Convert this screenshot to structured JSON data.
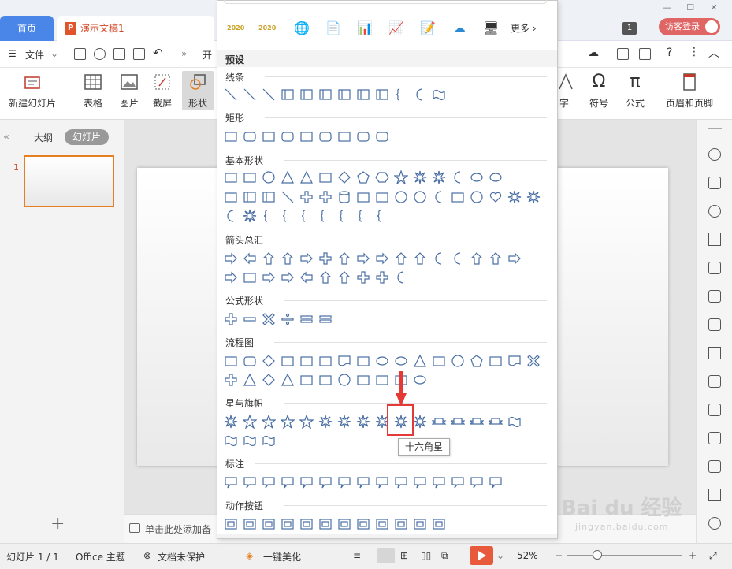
{
  "titlebar": {
    "home_tab": "首页",
    "doc_tab": "演示文稿1",
    "badge": "1",
    "login": "访客登录",
    "win_controls": [
      "—",
      "☐",
      "✕"
    ]
  },
  "menu": {
    "file": "文件",
    "partial_tab": "开"
  },
  "ribbon": {
    "new_slide": "新建幻灯片",
    "table": "表格",
    "picture": "图片",
    "screenshot": "截屏",
    "shape": "形状",
    "art": "字",
    "symbol": "符号",
    "formula": "公式",
    "header_footer": "页眉和页脚"
  },
  "left_panel": {
    "outline": "大纲",
    "slides": "幻灯片",
    "thumb_index": "1",
    "add": "+"
  },
  "notes": {
    "placeholder": "单击此处添加备"
  },
  "status": {
    "slide_count": "幻灯片 1 / 1",
    "theme": "Office 主题",
    "protect": "文档未保护",
    "beautify": "一键美化",
    "zoom": "52%"
  },
  "dropdown": {
    "recent_labels": [
      "2020",
      "2020"
    ],
    "more": "更多",
    "preset": "预设",
    "sections": [
      {
        "title": "线条"
      },
      {
        "title": "矩形"
      },
      {
        "title": "基本形状"
      },
      {
        "title": "箭头总汇"
      },
      {
        "title": "公式形状"
      },
      {
        "title": "流程图"
      },
      {
        "title": "星与旗帜"
      },
      {
        "title": "标注"
      },
      {
        "title": "动作按钮"
      }
    ],
    "tooltip": "十六角星"
  },
  "watermark": {
    "brand": "Bai du 经验",
    "url": "jingyan.baidu.com"
  },
  "colors": {
    "accent_blue": "#4a86e8",
    "ppt_orange": "#d24726",
    "highlight_red": "#e53935",
    "shape_stroke": "#4a6fa5"
  }
}
